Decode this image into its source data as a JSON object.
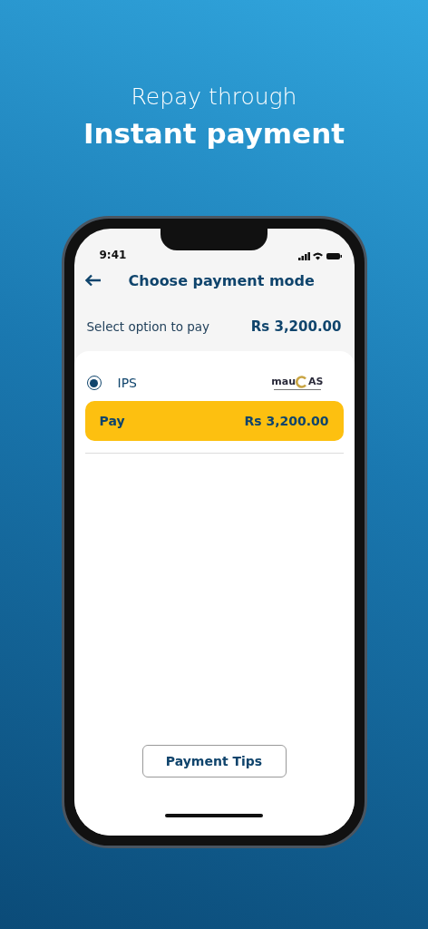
{
  "headline": {
    "line_1": "Repay through",
    "line_2": "Instant payment"
  },
  "status_bar": {
    "time": "9:41"
  },
  "header": {
    "title": "Choose payment mode"
  },
  "summary": {
    "label": "Select option to pay",
    "amount": "Rs 3,200.00"
  },
  "options": [
    {
      "name": "IPS",
      "selected": true,
      "logo": {
        "left": "mau",
        "right": "AS"
      }
    }
  ],
  "pay_button": {
    "label": "Pay",
    "amount": "Rs 3,200.00"
  },
  "tips_button": {
    "label": "Payment Tips"
  }
}
